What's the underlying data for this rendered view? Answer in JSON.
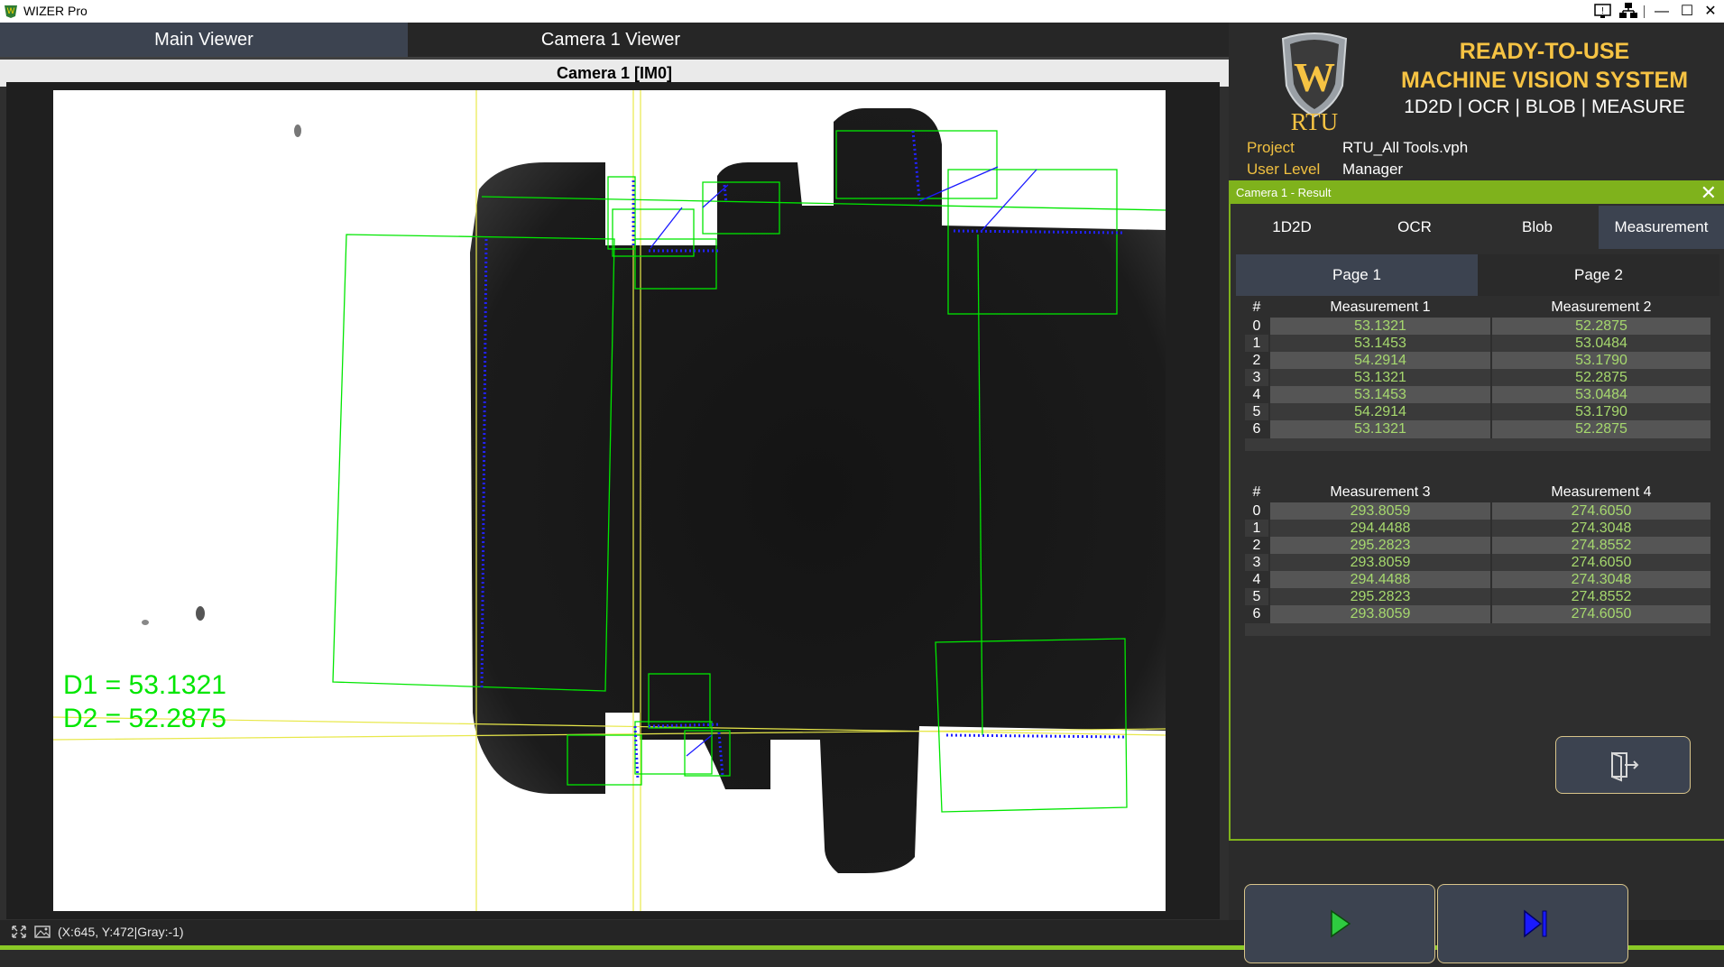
{
  "window": {
    "title": "WIZER Pro",
    "minimize": "—",
    "maximize": "☐",
    "close": "✕"
  },
  "tabs": [
    "Main Viewer",
    "Camera 1 Viewer"
  ],
  "viewer": {
    "title": "Camera 1  [IM0]",
    "overlay_d1": "D1 = 53.1321",
    "overlay_d2": "D2 = 52.2875"
  },
  "status": {
    "text": "(X:645, Y:472|Gray:-1)"
  },
  "branding": {
    "logo_text": "RTU",
    "headline_1": "READY-TO-USE",
    "headline_2": "MACHINE VISION SYSTEM",
    "subline": "1D2D | OCR | BLOB | MEASURE"
  },
  "info": {
    "project_label": "Project",
    "project_value": "RTU_All Tools.vph",
    "user_label": "User Level",
    "user_value": "Manager"
  },
  "result": {
    "title": "Camera 1 - Result",
    "close": "✕",
    "tabs": [
      "1D2D",
      "OCR",
      "Blob",
      "Measurement"
    ],
    "pages": [
      "Page 1",
      "Page 2"
    ],
    "table1": {
      "headers": [
        "#",
        "Measurement 1",
        "Measurement 2"
      ],
      "rows": [
        [
          "0",
          "53.1321",
          "52.2875"
        ],
        [
          "1",
          "53.1453",
          "53.0484"
        ],
        [
          "2",
          "54.2914",
          "53.1790"
        ],
        [
          "3",
          "53.1321",
          "52.2875"
        ],
        [
          "4",
          "53.1453",
          "53.0484"
        ],
        [
          "5",
          "54.2914",
          "53.1790"
        ],
        [
          "6",
          "53.1321",
          "52.2875"
        ]
      ]
    },
    "table2": {
      "headers": [
        "#",
        "Measurement 3",
        "Measurement 4"
      ],
      "rows": [
        [
          "0",
          "293.8059",
          "274.6050"
        ],
        [
          "1",
          "294.4488",
          "274.3048"
        ],
        [
          "2",
          "295.2823",
          "274.8552"
        ],
        [
          "3",
          "293.8059",
          "274.6050"
        ],
        [
          "4",
          "294.4488",
          "274.3048"
        ],
        [
          "5",
          "295.2823",
          "274.8552"
        ],
        [
          "6",
          "293.8059",
          "274.6050"
        ]
      ]
    }
  },
  "colors": {
    "accent_green": "#7fb21c",
    "value_green": "#a6d86e",
    "headline_gold": "#f6c343",
    "overlay_green": "#00e600",
    "play_green": "#2ecc40",
    "step_blue": "#1a1aff"
  },
  "icons": {
    "exit": "exit-door-icon",
    "run": "play-icon",
    "step": "step-forward-icon"
  }
}
